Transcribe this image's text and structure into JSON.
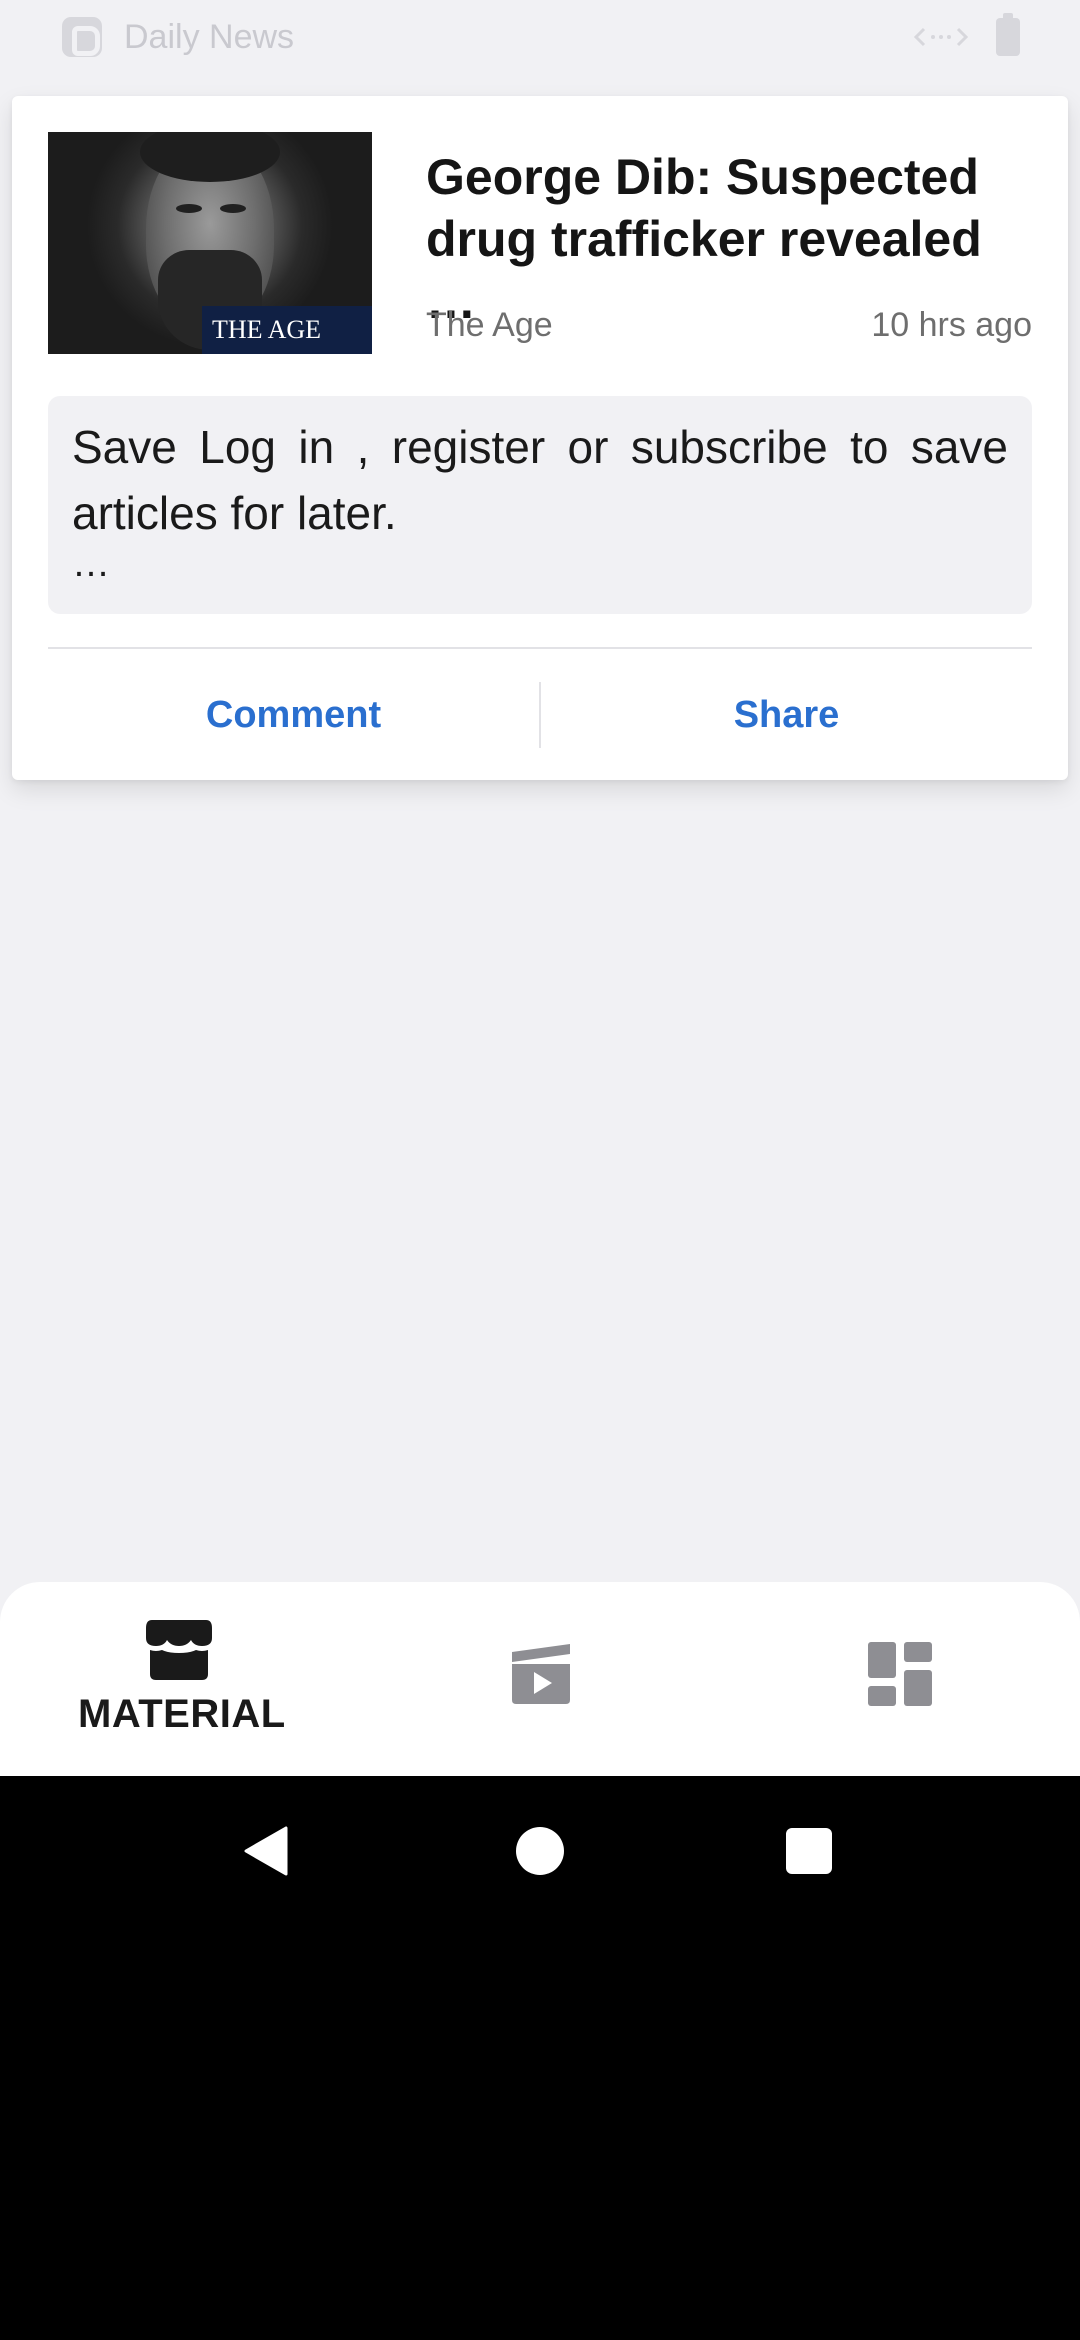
{
  "status_bar": {
    "app_title": "Daily News"
  },
  "article": {
    "headline": "George Dib: Suspected drug trafficker revealed …",
    "source": "The Age",
    "time_ago": "10 hrs ago",
    "thumbnail_banner": "THE AGE",
    "excerpt": "Save  Log in ,  register  or subscribe  to save articles for later.",
    "excerpt_more": "…"
  },
  "actions": {
    "comment_label": "Comment",
    "share_label": "Share"
  },
  "bottom_nav": {
    "items": [
      {
        "label": "MATERIAL",
        "icon": "store-icon",
        "active": true
      },
      {
        "label": "",
        "icon": "video-icon",
        "active": false
      },
      {
        "label": "",
        "icon": "dashboard-icon",
        "active": false
      }
    ]
  },
  "colors": {
    "accent": "#2a6fcf",
    "background": "#f1f1f4",
    "card": "#ffffff",
    "inactive_icon": "#8e8e93"
  }
}
